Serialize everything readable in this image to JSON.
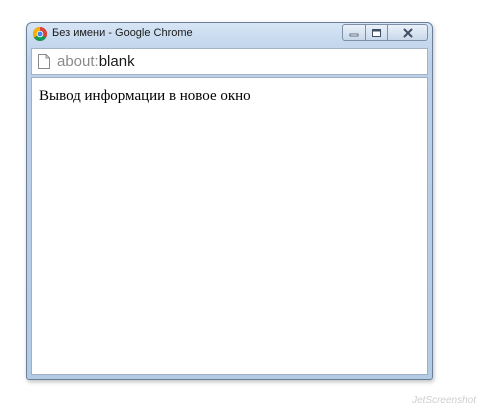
{
  "window": {
    "title": "Без имени - Google Chrome",
    "controls": {
      "minimize": "minimize-icon",
      "maximize": "maximize-icon",
      "close": "close-icon"
    }
  },
  "omnibox": {
    "scheme": "about:",
    "path": "blank",
    "icon": "page-icon"
  },
  "page": {
    "text": "Вывод информации в новое окно"
  },
  "watermark": {
    "text": "JetScreenshot"
  },
  "colors": {
    "frame": "#c6d9ee",
    "frame_border": "#6c7f99",
    "url_scheme": "#8a8a8a",
    "url_path": "#1a1a1a"
  }
}
